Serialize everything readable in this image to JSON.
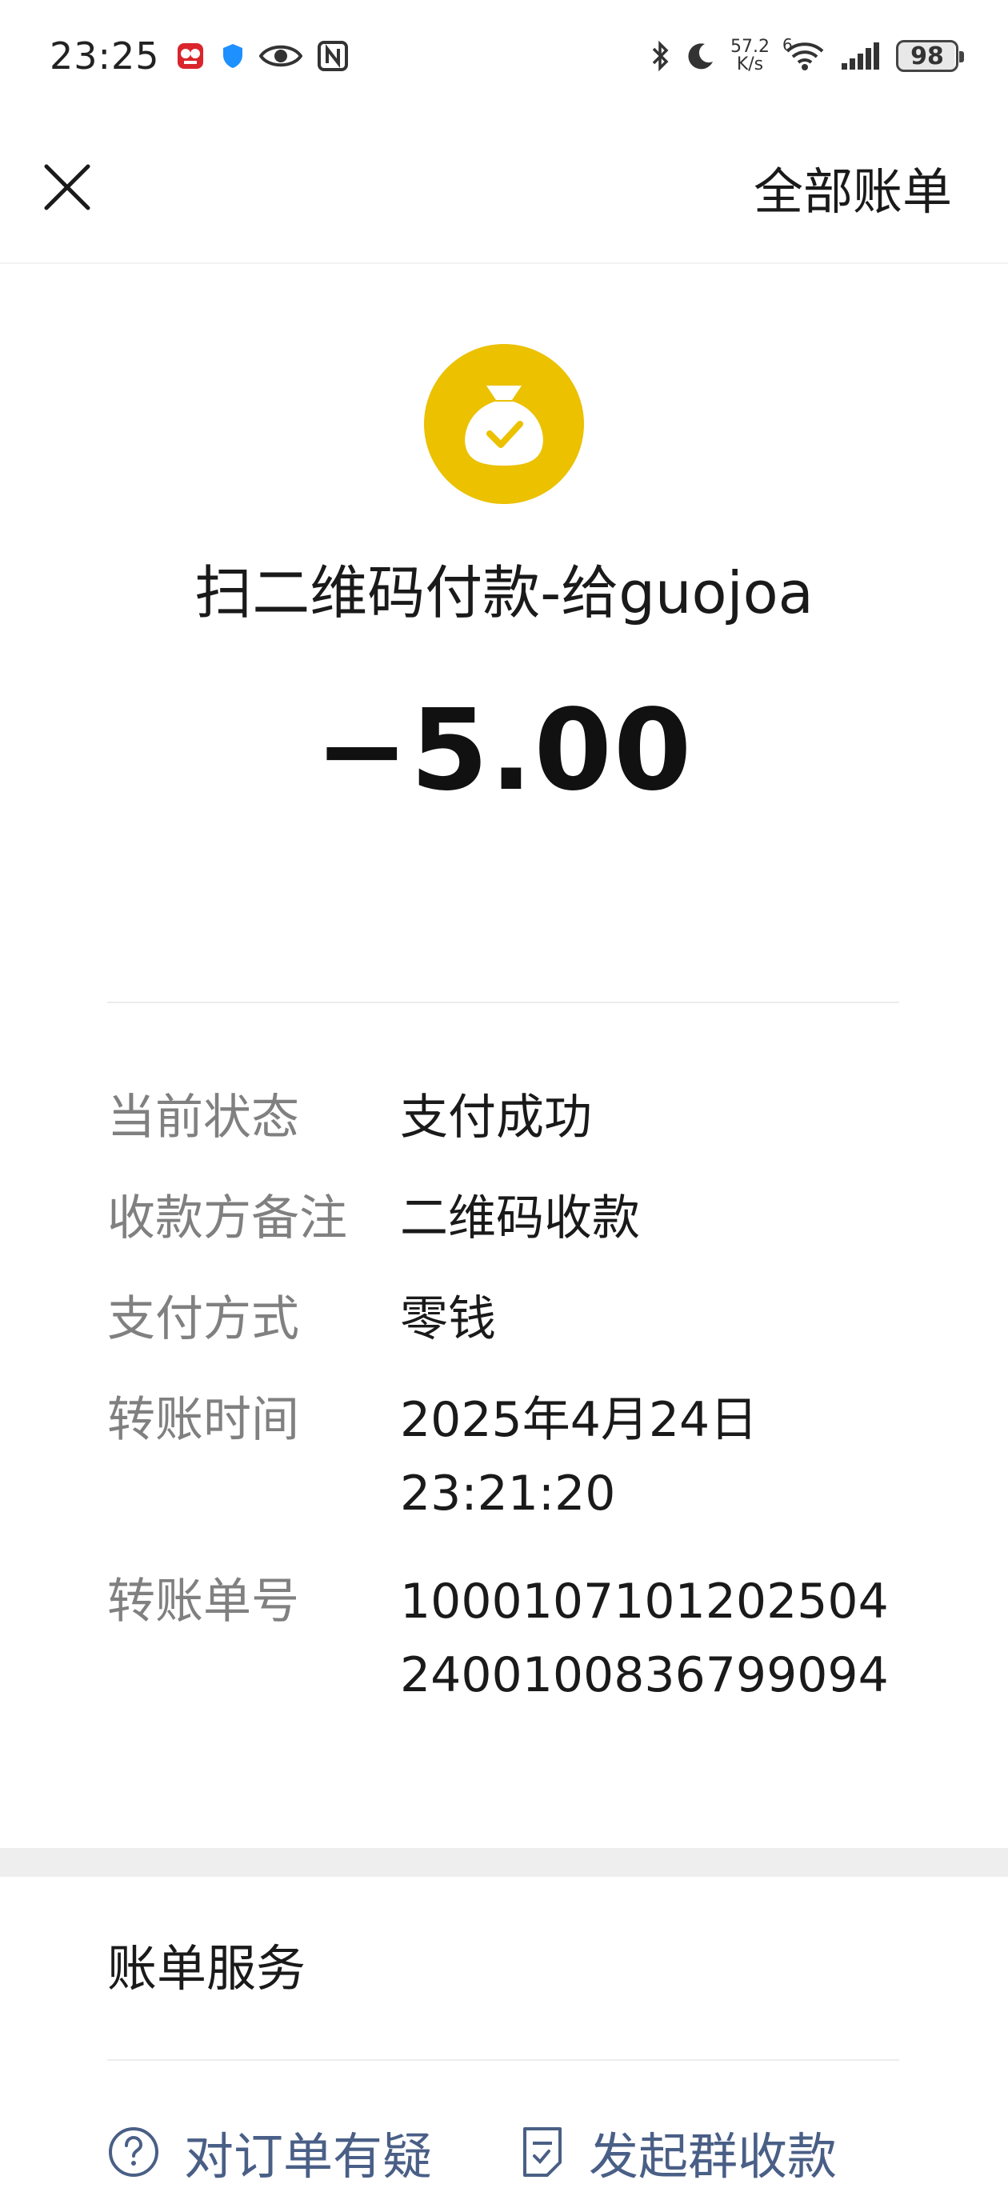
{
  "status_bar": {
    "time": "23:25",
    "net_speed_value": "57.2",
    "net_speed_unit": "K/s",
    "signal_label": "6",
    "battery": "98"
  },
  "nav": {
    "all_bills_label": "全部账单"
  },
  "transaction": {
    "title": "扫二维码付款-给guojoa",
    "amount": "−5.00",
    "icon": "money-bag-check-icon",
    "icon_color": "#EBC100"
  },
  "details": [
    {
      "label": "当前状态",
      "value_lines": [
        "支付成功"
      ]
    },
    {
      "label": "收款方备注",
      "value_lines": [
        "二维码收款"
      ]
    },
    {
      "label": "支付方式",
      "value_lines": [
        "零钱"
      ]
    },
    {
      "label": "转账时间",
      "value_lines": [
        "2025年4月24日",
        "23:21:20"
      ]
    },
    {
      "label": "转账单号",
      "value_lines": [
        "1000107101202504",
        "2400100836799094"
      ]
    }
  ],
  "service": {
    "title": "账单服务",
    "links": [
      {
        "label": "对订单有疑",
        "icon": "question-circle-icon"
      },
      {
        "label": "发起群收款",
        "icon": "document-check-icon"
      }
    ],
    "link_color": "#4A5F86"
  }
}
